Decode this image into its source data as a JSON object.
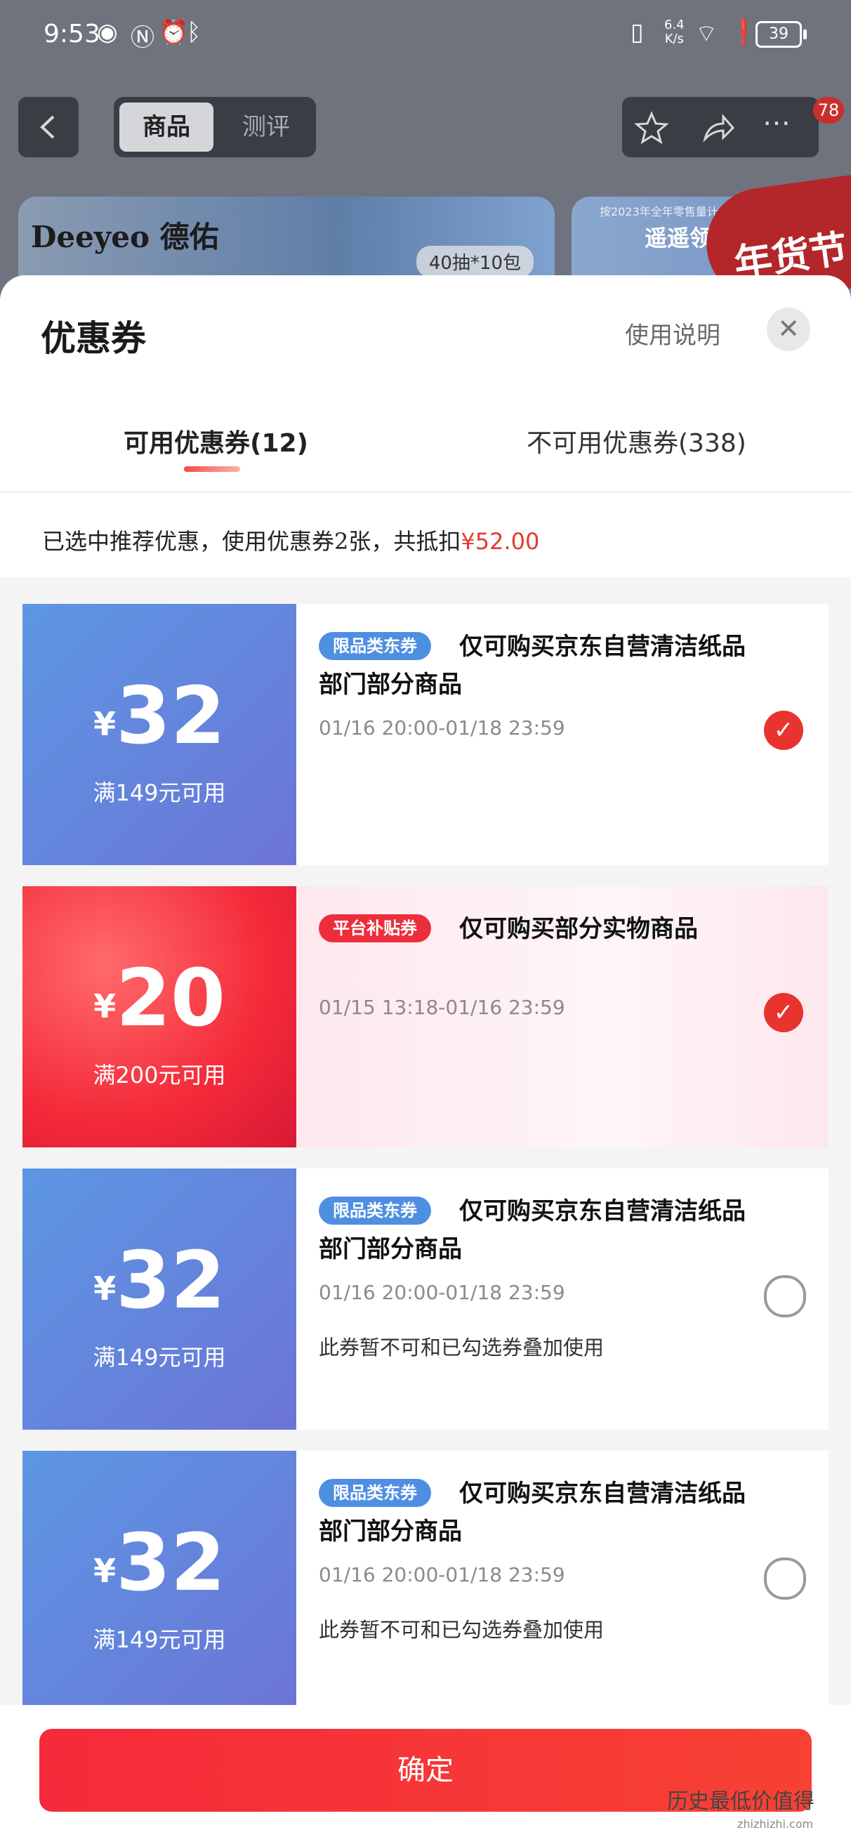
{
  "status_bar": {
    "time": "9:53",
    "net_speed": "6.4",
    "net_unit": "K/s",
    "battery": "39"
  },
  "page_nav": {
    "tabs": [
      "商品",
      "测评"
    ],
    "badge": "78"
  },
  "banners": {
    "brand": "Deeyeo 德佑",
    "pack": "40抽*10包",
    "small_text": "按2023年全年零售量计 遥",
    "big_text": "遥遥领",
    "promo": "年货节"
  },
  "sheet": {
    "title": "优惠券",
    "help_label": "使用说明",
    "close_glyph": "✕",
    "tabs": {
      "available": "可用优惠券(12)",
      "unavailable": "不可用优惠券(338)"
    },
    "summary_text": "已选中推荐优惠，使用优惠券2张，共抵扣",
    "summary_amount": "¥52.00"
  },
  "coupons": [
    {
      "amount": "32",
      "yen": "¥",
      "condition": "满149元可用",
      "tag": "限品类东券",
      "title": "仅可购买京东自营清洁纸品部门部分商品",
      "date": "01/16 20:00-01/18 23:59",
      "note": "",
      "selected": true
    },
    {
      "amount": "20",
      "yen": "¥",
      "condition": "满200元可用",
      "tag": "平台补贴券",
      "title": "仅可购买部分实物商品",
      "date": "01/15 13:18-01/16 23:59",
      "note": "",
      "selected": true
    },
    {
      "amount": "32",
      "yen": "¥",
      "condition": "满149元可用",
      "tag": "限品类东券",
      "title": "仅可购买京东自营清洁纸品部门部分商品",
      "date": "01/16 20:00-01/18 23:59",
      "note": "此券暂不可和已勾选券叠加使用",
      "selected": false
    },
    {
      "amount": "32",
      "yen": "¥",
      "condition": "满149元可用",
      "tag": "限品类东券",
      "title": "仅可购买京东自营清洁纸品部门部分商品",
      "date": "01/16 20:00-01/18 23:59",
      "note": "此券暂不可和已勾选券叠加使用",
      "selected": false
    }
  ],
  "confirm_label": "确定",
  "watermark": {
    "text": "历史最低价值得",
    "url_text": "zhizhizhi.com"
  },
  "colors": {
    "accent_red": "#e8332f",
    "coupon_blue": "#5c97e3"
  }
}
